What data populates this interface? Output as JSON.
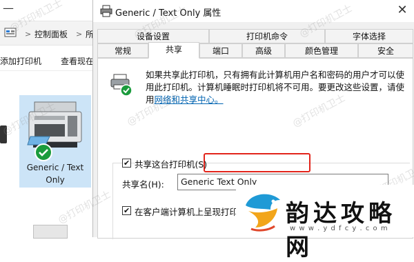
{
  "explorer": {
    "breadcrumb": {
      "sep1": ">",
      "item1": "控制面板",
      "sep2": ">",
      "item2": "所"
    },
    "commands": {
      "add_printer": "添加打印机",
      "view_current": "查看现在"
    },
    "printer": {
      "label_line1": "Generic / Text",
      "label_line2": "Only"
    }
  },
  "dialog": {
    "title": "Generic / Text Only 属性",
    "close_glyph": "✕",
    "tabs_row1": [
      "设备设置",
      "打印机命令",
      "字体选择"
    ],
    "tabs_row2": [
      "常规",
      "共享",
      "端口",
      "高级",
      "颜色管理",
      "安全"
    ],
    "active_tab": "共享",
    "info_text": "如果共享此打印机，只有拥有此计算机用户名和密码的用户才可以使用此打印机。计算机睡眠时打印机将不可用。要更改这些设置，请使用",
    "info_link": "网络和共享中心。",
    "share_checkbox_label": "共享这台打印机(S)",
    "share_checkbox_checked": true,
    "share_name_label": "共享名(H):",
    "share_name_value": "Generic  Text Only",
    "render_jobs_label": "在客户端计算机上呈现打印作",
    "render_jobs_checked": true
  },
  "watermark": "@打印机卫士",
  "logo": {
    "name": "韵达攻略网",
    "url": "w w w . y d f c y . c o m"
  },
  "colors": {
    "accent": "#0063b1",
    "highlight_border": "#e2231a",
    "selected_tile": "#cce4f7",
    "check_green": "#1a9b3c"
  }
}
